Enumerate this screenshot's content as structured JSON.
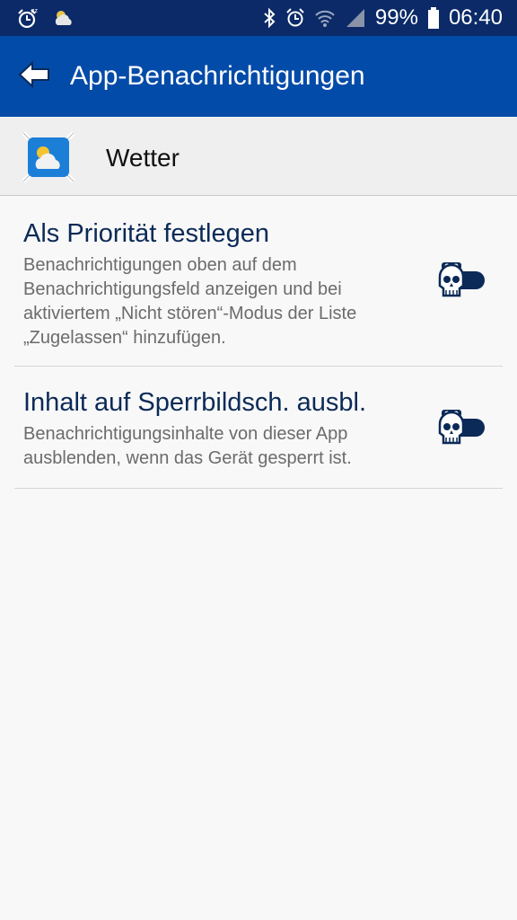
{
  "status_bar": {
    "battery_percent": "99%",
    "time": "06:40",
    "left_icons": [
      "alarm-snooze-icon",
      "weather-icon"
    ],
    "right_icons": [
      "bluetooth-icon",
      "alarm-icon",
      "wifi-icon",
      "signal-icon",
      "battery-icon"
    ]
  },
  "app_bar": {
    "title": "App-Benachrichtigungen",
    "back_icon": "back-arrow-icon",
    "color": "#034ba8"
  },
  "app": {
    "name": "Wetter",
    "icon": "weather-app-icon"
  },
  "settings": [
    {
      "title": "Als Priorität festlegen",
      "description": "Benachrichtigungen oben auf dem Benachrichtigungsfeld anzeigen und bei aktiviertem „Nicht stören“-Modus der Liste „Zugelassen“ hinzufügen.",
      "enabled": true
    },
    {
      "title": "Inhalt auf Sperrbildsch. ausbl.",
      "description": "Benachrichtigungsinhalte von dieser App ausblenden, wenn das Gerät gesperrt ist.",
      "enabled": true
    }
  ],
  "colors": {
    "status_bar": "#0b2a67",
    "accent": "#034ba8",
    "title_text": "#0b2a57",
    "toggle": "#0b2a57"
  }
}
